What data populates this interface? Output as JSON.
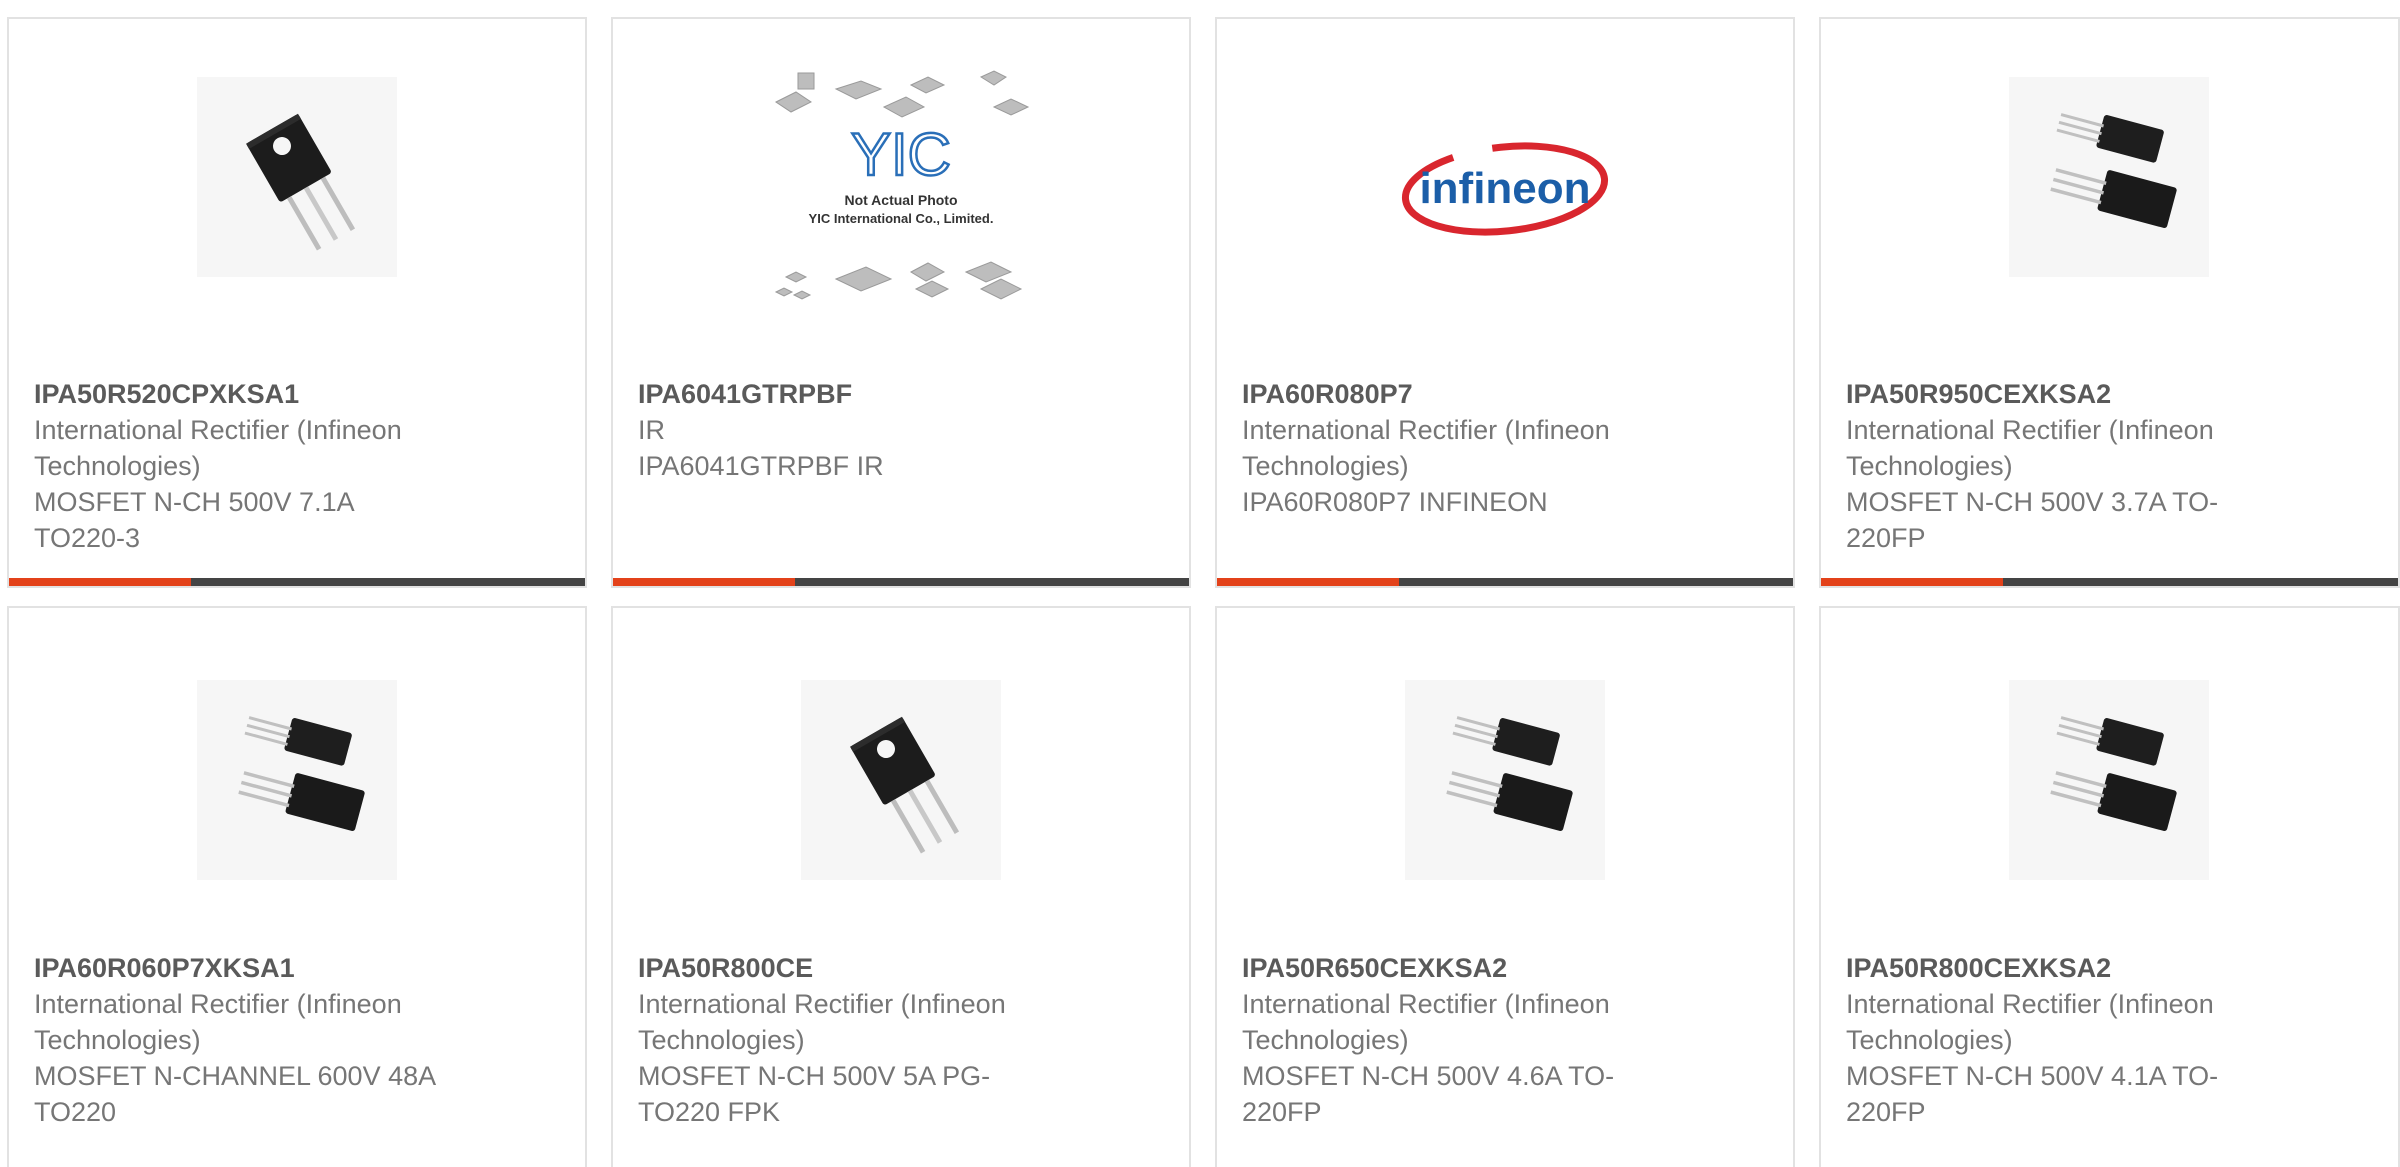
{
  "products": [
    {
      "part": "IPA50R520CPXKSA1",
      "maker": "International Rectifier (Infineon Technologies)",
      "maker_line1": "International Rectifier (Infineon",
      "maker_line2": "Technologies)",
      "desc_line1": "MOSFET N-CH 500V 7.1A",
      "desc_line2": "TO220-3",
      "image": "to220-fullpak-single"
    },
    {
      "part": "IPA6041GTRPBF",
      "maker_line1": "IR",
      "maker_line2": "",
      "desc_line1": "IPA6041GTRPBF IR",
      "desc_line2": "",
      "image": "yic-not-actual-photo",
      "image_text": {
        "logo": "YIC",
        "line1": "Not Actual Photo",
        "line2": "YIC International Co., Limited."
      }
    },
    {
      "part": "IPA60R080P7",
      "maker_line1": "International Rectifier (Infineon",
      "maker_line2": "Technologies)",
      "desc_line1": "IPA60R080P7 INFINEON",
      "desc_line2": "",
      "image": "infineon-logo",
      "image_text": {
        "logo": "infineon"
      }
    },
    {
      "part": "IPA50R950CEXKSA2",
      "maker_line1": "International Rectifier (Infineon",
      "maker_line2": "Technologies)",
      "desc_line1": "MOSFET N-CH 500V 3.7A TO-",
      "desc_line2": "220FP",
      "image": "to220fp-pair"
    },
    {
      "part": "IPA60R060P7XKSA1",
      "maker_line1": "International Rectifier (Infineon",
      "maker_line2": "Technologies)",
      "desc_line1": "MOSFET N-CHANNEL 600V 48A",
      "desc_line2": "TO220",
      "image": "to220fp-pair"
    },
    {
      "part": "IPA50R800CE",
      "maker_line1": "International Rectifier (Infineon",
      "maker_line2": "Technologies)",
      "desc_line1": "MOSFET N-CH 500V 5A PG-",
      "desc_line2": "TO220 FPK",
      "image": "to220-fullpak-single"
    },
    {
      "part": "IPA50R650CEXKSA2",
      "maker_line1": "International Rectifier (Infineon",
      "maker_line2": "Technologies)",
      "desc_line1": "MOSFET N-CH 500V 4.6A TO-",
      "desc_line2": "220FP",
      "image": "to220fp-pair"
    },
    {
      "part": "IPA50R800CEXKSA2",
      "maker_line1": "International Rectifier (Infineon",
      "maker_line2": "Technologies)",
      "desc_line1": "MOSFET N-CH 500V 4.1A TO-",
      "desc_line2": "220FP",
      "image": "to220fp-pair"
    }
  ],
  "colors": {
    "accent": "#e3421a",
    "bar": "#444444",
    "border": "#e2e2e2",
    "part_text": "#5a5a5a",
    "body_text": "#767676",
    "infineon_red": "#d9262e",
    "infineon_blue": "#1b5ea8",
    "yic_blue": "#2a6fb8"
  }
}
